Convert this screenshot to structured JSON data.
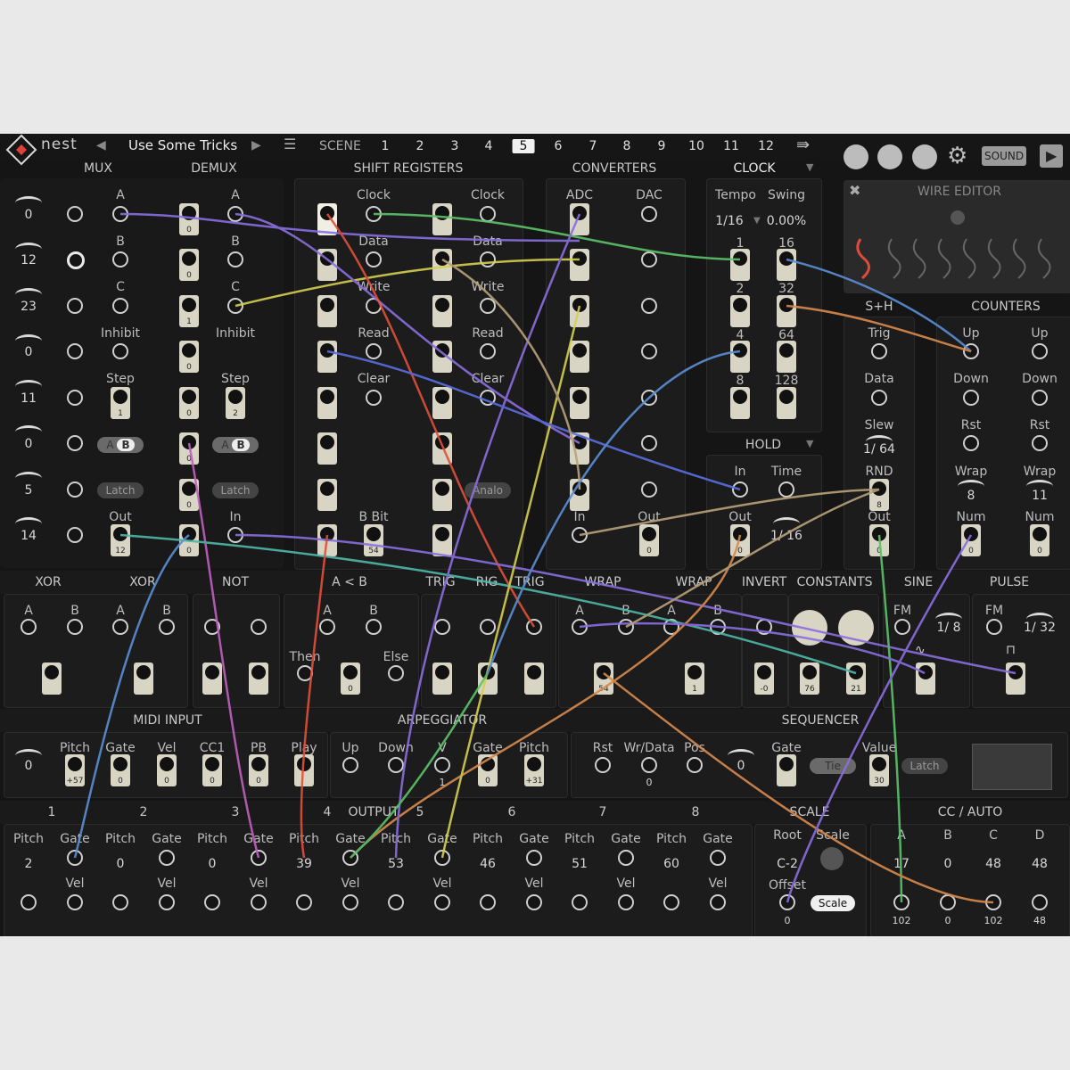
{
  "app": {
    "logo": "nest",
    "preset": "Use Some Tricks"
  },
  "scenes": {
    "label": "SCENE",
    "numbers": [
      "1",
      "2",
      "3",
      "4",
      "5",
      "6",
      "7",
      "8",
      "9",
      "10",
      "11",
      "12"
    ],
    "active": "5"
  },
  "toolbar": {
    "sound_label": "SOUND"
  },
  "headers": {
    "mux": "MUX",
    "demux": "DEMUX",
    "shift": "SHIFT REGISTERS",
    "converters": "CONVERTERS",
    "clock": "CLOCK",
    "wire_editor": "WIRE EDITOR",
    "snh": "S+H",
    "counters": "COUNTERS",
    "hold": "HOLD",
    "xor1": "XOR",
    "xor2": "XOR",
    "not": "NOT",
    "altb": "A < B",
    "trig1": "TRIG",
    "trig2": "RIG",
    "trig3": "TRIG",
    "wrap1": "WRAP",
    "wrap2": "WRAP",
    "invert": "INVERT",
    "constants": "CONSTANTS",
    "sine": "SINE",
    "pulse": "PULSE",
    "midi": "MIDI INPUT",
    "arp": "ARPEGGIATOR",
    "seq": "SEQUENCER",
    "out1": "1",
    "out2": "2",
    "out3": "3",
    "out4": "4",
    "output": "OUTPUT",
    "out5": "5",
    "out6": "6",
    "out7": "7",
    "out8": "8",
    "scale": "SCALE",
    "ccauto": "CC / AUTO"
  },
  "mux_values": [
    "0",
    "12",
    "23",
    "0",
    "11",
    "0",
    "5",
    "14"
  ],
  "labels": {
    "a": "A",
    "b": "B",
    "c": "C",
    "inhibit": "Inhibit",
    "step": "Step",
    "out": "Out",
    "in": "In",
    "ab_a": "A",
    "ab_b": "B",
    "latch": "Latch",
    "clock": "Clock",
    "data": "Data",
    "write": "Write",
    "read": "Read",
    "clear": "Clear",
    "analog": "Analo",
    "bbit": "B Bit",
    "adc": "ADC",
    "dac": "DAC",
    "tempo": "Tempo",
    "swing": "Swing",
    "tempo_val": "1/16",
    "swing_val": "0.00%",
    "clk1": "1",
    "clk16": "16",
    "clk2": "2",
    "clk32": "32",
    "clk4": "4",
    "clk64": "64",
    "clk8": "8",
    "clk128": "128",
    "time": "Time",
    "hold_time": "1/ 16",
    "trig": "Trig",
    "slew": "Slew",
    "slew_val": "1/ 64",
    "rnd": "RND",
    "up": "Up",
    "down": "Down",
    "rst": "Rst",
    "wrap": "Wrap",
    "wrap_val1": "8",
    "wrap_val2": "11",
    "num": "Num",
    "then": "Then",
    "else": "Else",
    "fm": "FM",
    "sine_rate": "1/ 8",
    "pulse_rate": "1/ 32",
    "pitch": "Pitch",
    "gate": "Gate",
    "vel": "Vel",
    "cc1": "CC1",
    "pb": "PB",
    "play": "Play",
    "v": "V",
    "v_val": "1",
    "rst2": "Rst",
    "wrdata": "Wr/Data",
    "pos": "Pos",
    "pos_val": "0",
    "seq_zero": "0",
    "tie": "Tie",
    "value": "Value",
    "root": "Root",
    "scale": "Scale",
    "offset": "Offset",
    "root_val": "C-2",
    "offset_val": "0",
    "scale_btn": "Scale",
    "midi_zero": "0",
    "cc_a": "A",
    "cc_b": "B",
    "cc_c": "C",
    "cc_d": "D"
  },
  "socket_values": {
    "demux_a": "0",
    "demux_b": "0",
    "demux_c": "1",
    "inh1": "0",
    "inh2": "0",
    "step1": "1",
    "step2": "2",
    "dmx_ab": "0",
    "dmx_latch": "0",
    "mux_out": "12",
    "dmx_out": "0",
    "bbit": "54",
    "dac_out": "0",
    "hold_out": "0",
    "rnd": "8",
    "snh_out": "0",
    "num1": "0",
    "num2": "0",
    "wrap1": "54",
    "wrap2": "1",
    "inv": "-0",
    "const1": "76",
    "const2": "21",
    "altb": "0",
    "midi_pitch": "+57",
    "midi_gate": "0",
    "midi_vel": "0",
    "midi_cc1": "0",
    "midi_pb": "0",
    "arp_pitch": "+31",
    "arp_gate": "0",
    "seq_value": "30"
  },
  "output_pitches": [
    "2",
    "0",
    "0",
    "39",
    "53",
    "46",
    "51",
    "60"
  ],
  "cc_values": [
    "17",
    "0",
    "48",
    "48"
  ],
  "cc_outputs": [
    "102",
    "0",
    "102",
    "48"
  ],
  "colors": {
    "bg": "#151515",
    "panel": "#1c1c1c",
    "socket": "#d9d5c4",
    "wire_purple": "#8a6fe0",
    "wire_green": "#5cc46a",
    "wire_orange": "#d98a4c",
    "wire_yellow": "#d6cf50",
    "wire_red": "#e0503a",
    "wire_blue": "#5b8fd6",
    "wire_tan": "#b8a27a"
  }
}
